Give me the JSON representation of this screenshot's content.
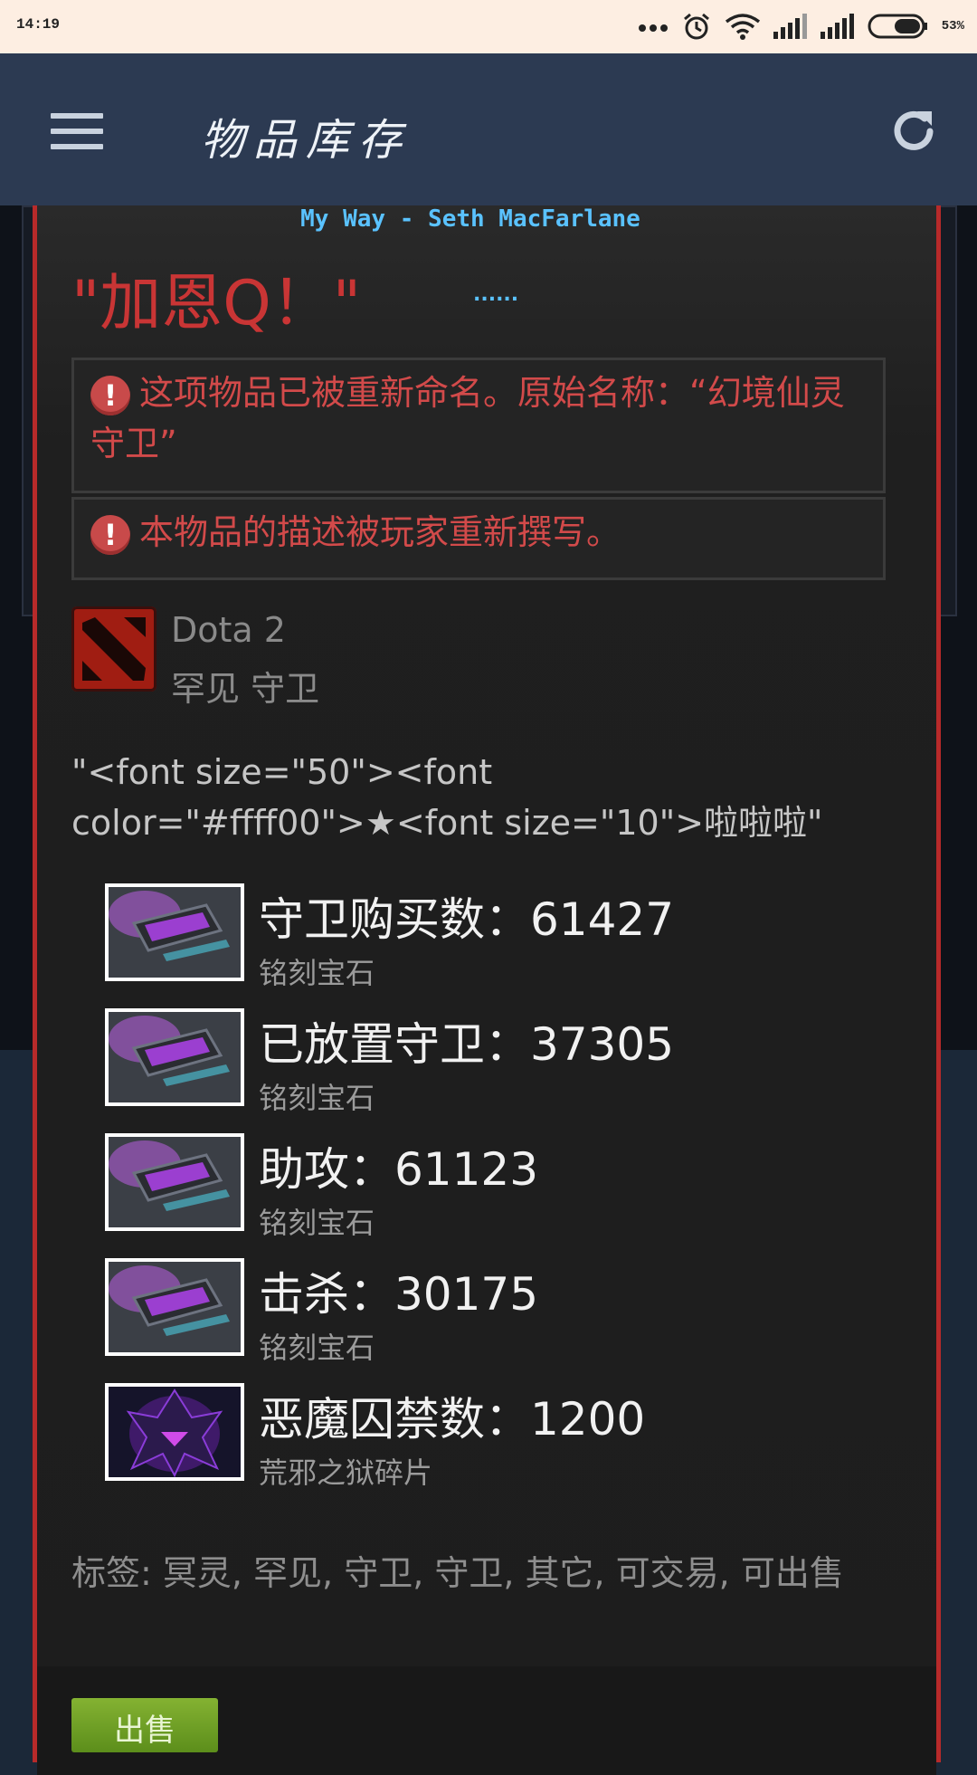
{
  "status_bar": {
    "time": "14:19",
    "battery": "53%",
    "icons": [
      "more-dots-icon",
      "alarm-icon",
      "wifi-icon",
      "signal-icon",
      "signal-icon",
      "battery-icon"
    ]
  },
  "header": {
    "title": "物品库存",
    "menu_icon": "hamburger-menu-icon",
    "refresh_icon": "refresh-icon"
  },
  "item": {
    "music_line": "My Way - Seth MacFarlane",
    "custom_name": "\"加恩Q！\"",
    "dots": "......",
    "rename_notice": "这项物品已被重新命名。原始名称：“幻境仙灵守卫”",
    "desc_notice": "本物品的描述被玩家重新撰写。",
    "game_name": "Dota 2",
    "rarity_type": "罕见 守卫",
    "description": "\"<font size=\"50\"><font color=\"#ffff00\">★<font size=\"10\">啦啦啦\"",
    "gems": [
      {
        "label": "守卫购买数：61427",
        "type": "铭刻宝石",
        "icon": "inscribed-gem-icon"
      },
      {
        "label": "已放置守卫：37305",
        "type": "铭刻宝石",
        "icon": "inscribed-gem-icon"
      },
      {
        "label": "助攻：61123",
        "type": "铭刻宝石",
        "icon": "inscribed-gem-icon"
      },
      {
        "label": "击杀：30175",
        "type": "铭刻宝石",
        "icon": "inscribed-gem-icon"
      },
      {
        "label": "恶魔囚禁数：1200",
        "type": "荒邪之狱碎片",
        "icon": "demon-shard-icon"
      }
    ],
    "tags": "标签: 冥灵, 罕见, 守卫, 守卫, 其它, 可交易, 可出售",
    "sell_label": "出售"
  },
  "colors": {
    "header_bg": "#2c3a52",
    "card_border": "#b72a2a",
    "warning_text": "#d24a4a",
    "music_text": "#5ac2ff",
    "sell_button": "#6fa12a"
  }
}
